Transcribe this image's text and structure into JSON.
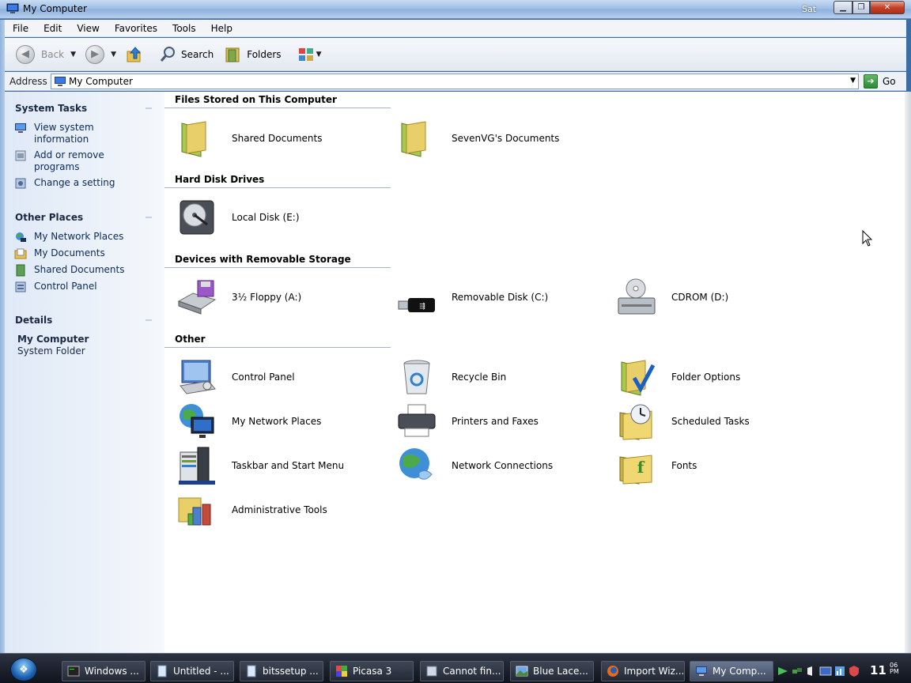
{
  "window": {
    "title": "My Computer",
    "clock_partial": "Sat"
  },
  "menu": [
    "File",
    "Edit",
    "View",
    "Favorites",
    "Tools",
    "Help"
  ],
  "toolbar": {
    "back_label": "Back",
    "search_label": "Search",
    "folders_label": "Folders"
  },
  "address": {
    "label": "Address",
    "value": "My Computer",
    "go_label": "Go"
  },
  "taskpane": {
    "system_tasks": {
      "title": "System Tasks",
      "items": [
        "View system information",
        "Add or remove programs",
        "Change a setting"
      ]
    },
    "other_places": {
      "title": "Other Places",
      "items": [
        "My Network Places",
        "My Documents",
        "Shared Documents",
        "Control Panel"
      ]
    },
    "details": {
      "title": "Details",
      "name": "My Computer",
      "type": "System Folder"
    }
  },
  "groups": [
    {
      "title": "Files Stored on This Computer",
      "items": [
        {
          "label": "Shared Documents",
          "icon": "folder-icon"
        },
        {
          "label": "SevenVG's Documents",
          "icon": "folder-icon"
        }
      ]
    },
    {
      "title": "Hard Disk Drives",
      "items": [
        {
          "label": "Local Disk (E:)",
          "icon": "hard-disk-icon"
        }
      ]
    },
    {
      "title": "Devices with Removable Storage",
      "items": [
        {
          "label": "3½ Floppy (A:)",
          "icon": "floppy-drive-icon"
        },
        {
          "label": "Removable Disk (C:)",
          "icon": "usb-drive-icon"
        },
        {
          "label": "CDROM (D:)",
          "icon": "cdrom-drive-icon"
        }
      ]
    },
    {
      "title": "Other",
      "items": [
        {
          "label": "Control Panel",
          "icon": "control-panel-icon"
        },
        {
          "label": "Recycle Bin",
          "icon": "recycle-bin-icon"
        },
        {
          "label": "Folder Options",
          "icon": "folder-options-icon"
        },
        {
          "label": "My Network Places",
          "icon": "network-places-icon"
        },
        {
          "label": "Printers and Faxes",
          "icon": "printer-icon"
        },
        {
          "label": "Scheduled Tasks",
          "icon": "scheduled-tasks-icon"
        },
        {
          "label": "Taskbar and Start Menu",
          "icon": "taskbar-icon"
        },
        {
          "label": "Network Connections",
          "icon": "network-connections-icon"
        },
        {
          "label": "Fonts",
          "icon": "fonts-icon"
        },
        {
          "label": "Administrative Tools",
          "icon": "admin-tools-icon"
        }
      ]
    }
  ],
  "taskbar": {
    "buttons": [
      "Windows ...",
      "Untitled - ...",
      "bitssetup ...",
      "Picasa 3",
      "Cannot fin...",
      "Blue Lace...",
      "Import Wiz...",
      "My Comp..."
    ],
    "clock_hour": "11",
    "clock_min": "06",
    "clock_ampm": "PM"
  }
}
